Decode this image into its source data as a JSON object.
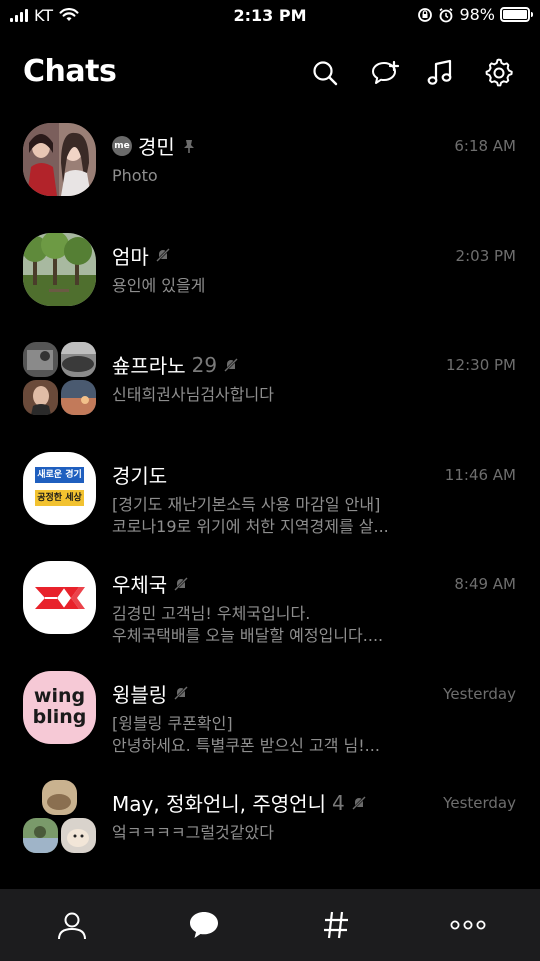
{
  "status_bar": {
    "carrier": "KT",
    "time": "2:13 PM",
    "battery": "98%",
    "battery_level": 0.98
  },
  "header": {
    "title": "Chats",
    "icons": [
      "search-icon",
      "new-chat-icon",
      "music-icon",
      "settings-icon"
    ]
  },
  "chats": [
    {
      "name": "경민",
      "me": "me",
      "pinned": true,
      "preview": [
        "Photo"
      ],
      "time": "6:18 AM"
    },
    {
      "name": "엄마",
      "muted": true,
      "preview": [
        "용인에 있을게"
      ],
      "time": "2:03 PM"
    },
    {
      "name": "숖프라노",
      "count": "29",
      "muted": true,
      "preview": [
        "신태희권사님검사합니다"
      ],
      "time": "12:30 PM"
    },
    {
      "name": "경기도",
      "preview": [
        "[경기도 재난기본소득 사용 마감일 안내]",
        "코로나19로 위기에 처한 지역경제를 살..."
      ],
      "time": "11:46 AM",
      "logo_lines": [
        "새로운 경기",
        "공정한 세상"
      ]
    },
    {
      "name": "우체국",
      "muted": true,
      "preview": [
        "김경민 고객님! 우체국입니다.",
        "우체국택배를 오늘 배달할 예정입니다...."
      ],
      "time": "8:49 AM"
    },
    {
      "name": "윙블링",
      "muted": true,
      "preview": [
        "[윙블링 쿠폰확인]",
        "안녕하세요. 특별쿠폰 받으신 고객 님!..."
      ],
      "time": "Yesterday",
      "logo_lines": [
        "wing",
        "bling"
      ]
    },
    {
      "name": "May, 정화언니, 주영언니",
      "count": "4",
      "muted": true,
      "preview": [
        "엌ㅋㅋㅋㅋ그럴것같았다"
      ],
      "time": "Yesterday"
    }
  ],
  "tabs": [
    "friends-tab",
    "chats-tab",
    "openchat-tab",
    "more-tab"
  ]
}
